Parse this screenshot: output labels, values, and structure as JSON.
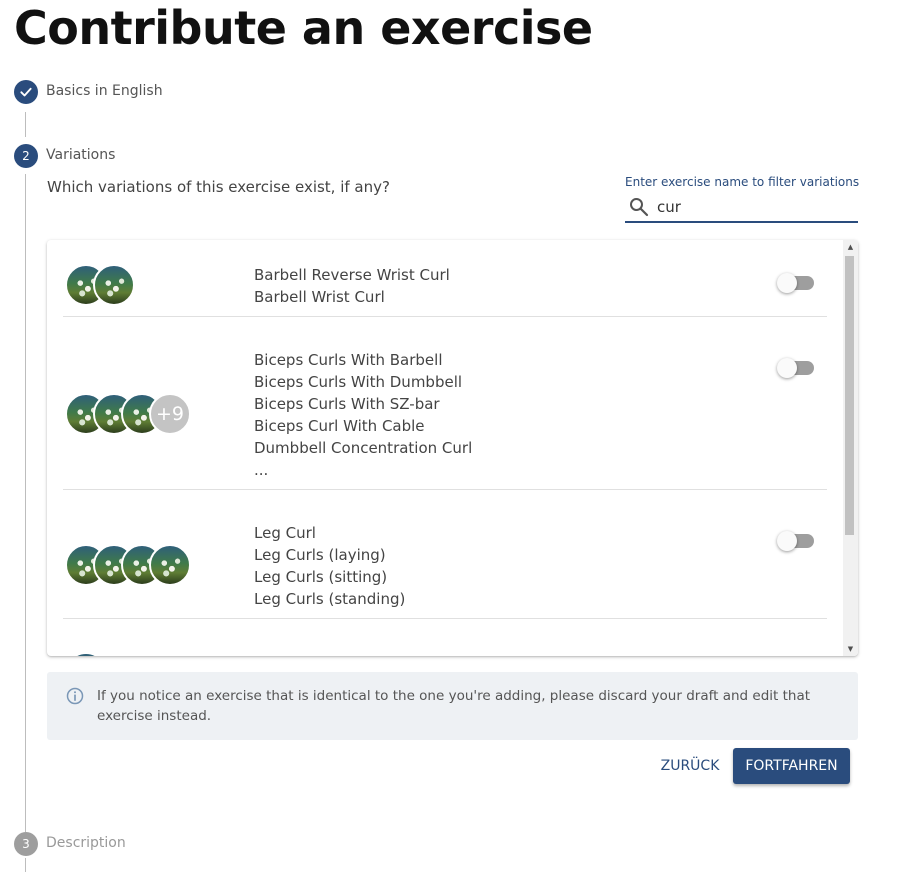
{
  "page_title": "Contribute an exercise",
  "steps": [
    {
      "number": "",
      "label": "Basics in English",
      "status": "done"
    },
    {
      "number": "2",
      "label": "Variations",
      "status": "active"
    },
    {
      "number": "3",
      "label": "Description",
      "status": "future"
    }
  ],
  "variations": {
    "question": "Which variations of this exercise exist, if any?",
    "search_label": "Enter exercise name to filter variations",
    "search_value": "cur",
    "groups": [
      {
        "names": [
          "Barbell Reverse Wrist Curl",
          "Barbell Wrist Curl"
        ],
        "extra_count": ""
      },
      {
        "names": [
          "Biceps Curls With Barbell",
          "Biceps Curls With Dumbbell",
          "Biceps Curls With SZ-bar",
          "Biceps Curl With Cable",
          "Dumbbell Concentration Curl",
          "..."
        ],
        "extra_count": "+9"
      },
      {
        "names": [
          "Leg Curl",
          "Leg Curls (laying)",
          "Leg Curls (sitting)",
          "Leg Curls (standing)"
        ],
        "extra_count": ""
      }
    ]
  },
  "alert": {
    "message": "If you notice an exercise that is identical to the one you're adding, please discard your draft and edit that exercise instead."
  },
  "buttons": {
    "back_label": "ZURÜCK",
    "next_label": "FORTFAHREN"
  },
  "colors": {
    "primary": "#2a4c7d",
    "step_future": "#9e9e9e",
    "alert_bg": "#eef1f4"
  }
}
